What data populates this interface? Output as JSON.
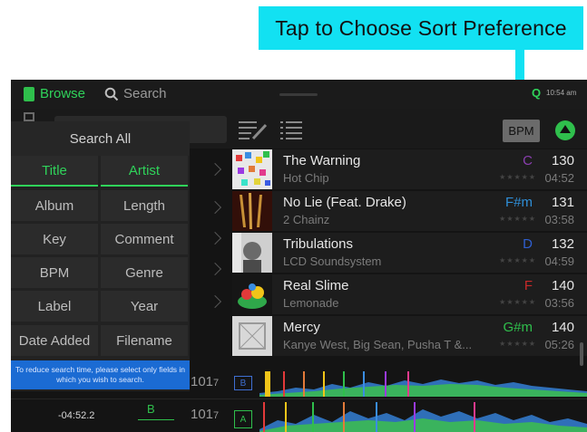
{
  "callout": {
    "text": "Tap to Choose Sort Preference",
    "color": "#12e1f2"
  },
  "topbar": {
    "browse_label": "Browse",
    "search_label": "Search",
    "quantize_label": "Q",
    "clock": "10:54 am"
  },
  "toolbar": {
    "sort_button_label": "BPM",
    "sort_direction": "ascending"
  },
  "search_panel": {
    "header": "Search All",
    "fields": [
      {
        "label": "Title",
        "selected": true
      },
      {
        "label": "Artist",
        "selected": true
      },
      {
        "label": "Album",
        "selected": false
      },
      {
        "label": "Length",
        "selected": false
      },
      {
        "label": "Key",
        "selected": false
      },
      {
        "label": "Comment",
        "selected": false
      },
      {
        "label": "BPM",
        "selected": false
      },
      {
        "label": "Genre",
        "selected": false
      },
      {
        "label": "Label",
        "selected": false
      },
      {
        "label": "Year",
        "selected": false
      },
      {
        "label": "Date Added",
        "selected": false
      },
      {
        "label": "Filename",
        "selected": false
      }
    ],
    "note": "To reduce search time, please select only fields in which you wish to search."
  },
  "tracks": [
    {
      "title": "The Warning",
      "artist": "Hot Chip",
      "key": "C",
      "key_color": "#8a3fb0",
      "bpm": "130",
      "length": "04:52"
    },
    {
      "title": "No Lie (Feat. Drake)",
      "artist": "2 Chainz",
      "key": "F#m",
      "key_color": "#2f8fd8",
      "bpm": "131",
      "length": "03:58"
    },
    {
      "title": "Tribulations",
      "artist": "LCD Soundsystem",
      "key": "D",
      "key_color": "#2f5fd0",
      "bpm": "132",
      "length": "04:59"
    },
    {
      "title": "Real Slime",
      "artist": "Lemonade",
      "key": "F",
      "key_color": "#c82a2a",
      "bpm": "140",
      "length": "03:56"
    },
    {
      "title": "Mercy",
      "artist": "Kanye West, Big Sean, Pusha T &...",
      "key": "G#m",
      "key_color": "#2fbf4c",
      "bpm": "140",
      "length": "05:26"
    }
  ],
  "decks": {
    "b": {
      "label": "B",
      "bpm_main": "101",
      "bpm_small": "7"
    },
    "a": {
      "label": "A",
      "time_main": "-04:52.",
      "time_small": "2",
      "key": "B",
      "bpm_main": "101",
      "bpm_small": "7"
    }
  }
}
